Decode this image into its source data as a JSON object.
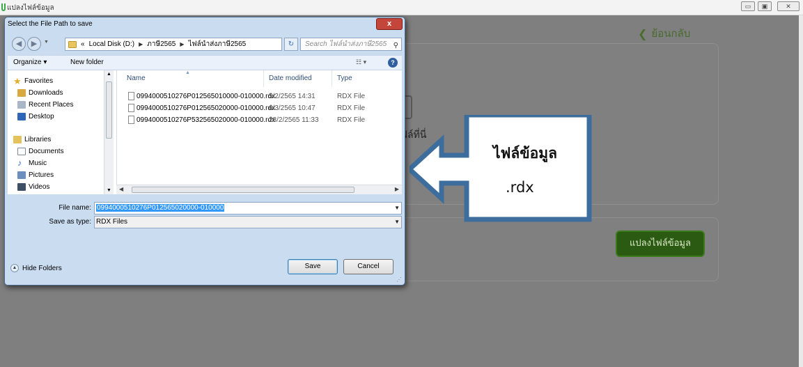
{
  "app": {
    "title": "แปลงไฟล์ข้อมูล",
    "back_label": "ย้อนกลับ",
    "upload_hint": "ไฟล์ที่นี่",
    "convert_button": "แปลงไฟล์ข้อมูล"
  },
  "callout": {
    "line1": "ไฟล์ข้อมูล",
    "line2": ".rdx"
  },
  "dialog": {
    "title": "Select the File Path to save",
    "close_label": "x",
    "path": [
      "Local Disk (D:)",
      "ภาษี2565",
      "ไฟล์นำส่งภาษี2565"
    ],
    "path_prefix": "«",
    "search_placeholder": "Search ไฟล์นำส่งภาษี2565",
    "toolbar": {
      "organize": "Organize ▾",
      "new_folder": "New folder"
    },
    "nav": {
      "favorites": "Favorites",
      "downloads": "Downloads",
      "recent_places": "Recent Places",
      "desktop": "Desktop",
      "libraries": "Libraries",
      "documents": "Documents",
      "music": "Music",
      "pictures": "Pictures",
      "videos": "Videos"
    },
    "columns": {
      "name": "Name",
      "date_modified": "Date modified",
      "type": "Type"
    },
    "files": [
      {
        "name": "0994000510276P012565010000-010000.rdx",
        "date": "5/2/2565 14:31",
        "type": "RDX File"
      },
      {
        "name": "0994000510276P012565020000-010000.rdx",
        "date": "6/3/2565 10:47",
        "type": "RDX File"
      },
      {
        "name": "0994000510276P532565020000-010000.rdx",
        "date": "28/2/2565 11:33",
        "type": "RDX File"
      }
    ],
    "file_name_label": "File name:",
    "file_name_value": "0994000510276P012565020000-010000",
    "save_as_label": "Save as type:",
    "save_as_value": "RDX Files",
    "hide_folders": "Hide Folders",
    "save_button": "Save",
    "cancel_button": "Cancel"
  }
}
